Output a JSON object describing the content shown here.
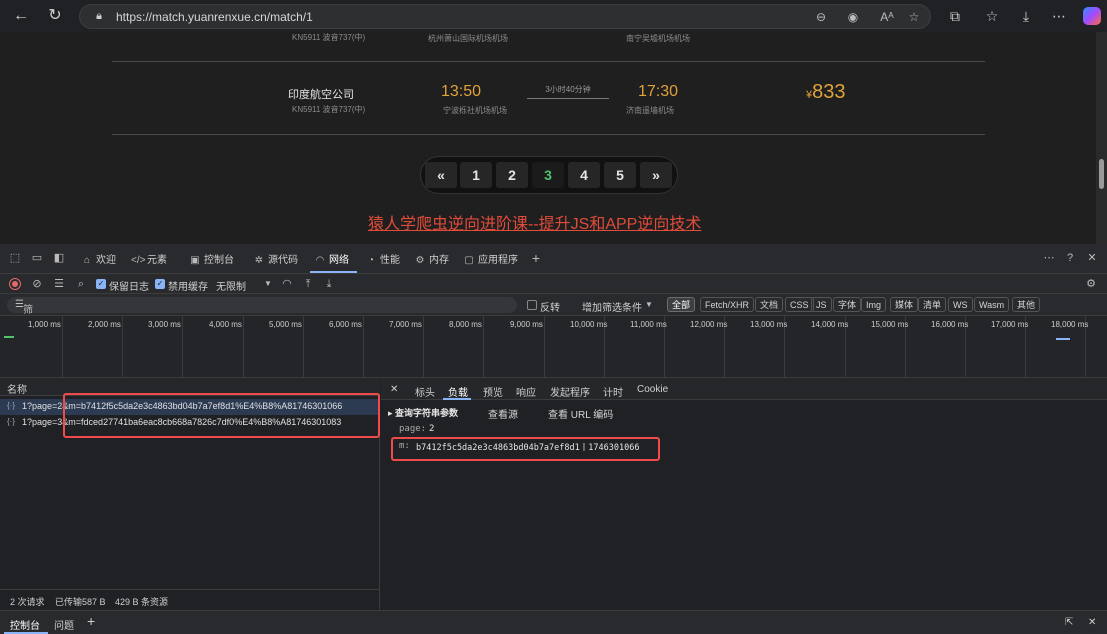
{
  "browser": {
    "url": "https://match.yuanrenxue.cn/match/1"
  },
  "page": {
    "prev_flight": {
      "code": "KN5911 波音737(中)",
      "from_airport": "杭州萧山国际机场机场",
      "to_airport": "南宁吴墟机场机场"
    },
    "flight": {
      "airline": "印度航空公司",
      "code": "KN5911 波音737(中)",
      "depart_time": "13:50",
      "depart_airport": "宁波栎社机场机场",
      "duration": "3小时40分钟",
      "arrive_time": "17:30",
      "arrive_airport": "济南遥墙机场",
      "currency": "¥",
      "price": "833"
    },
    "pagination": {
      "prev": "«",
      "pages": [
        "1",
        "2",
        "3",
        "4",
        "5"
      ],
      "active_page": "3",
      "next": "»"
    },
    "promo_link": "猿人学爬虫逆向进阶课--提升JS和APP逆向技术"
  },
  "devtools": {
    "tabs": [
      "欢迎",
      "元素",
      "控制台",
      "源代码",
      "网络",
      "性能",
      "内存",
      "应用程序"
    ],
    "active_tab": "网络",
    "toolbar": {
      "preserve_log": "保留日志",
      "disable_cache": "禁用缓存",
      "throttle": "无限制"
    },
    "filter": {
      "placeholder": "筛选器",
      "invert": "反转",
      "more_filters": "增加筛选条件",
      "types": [
        "全部",
        "Fetch/XHR",
        "文档",
        "CSS",
        "JS",
        "字体",
        "Img",
        "媒体",
        "清单",
        "WS",
        "Wasm",
        "其他"
      ],
      "active_type": "全部"
    },
    "timeline_ticks": [
      "1,000 ms",
      "2,000 ms",
      "3,000 ms",
      "4,000 ms",
      "5,000 ms",
      "6,000 ms",
      "7,000 ms",
      "8,000 ms",
      "9,000 ms",
      "10,000 ms",
      "11,000 ms",
      "12,000 ms",
      "13,000 ms",
      "14,000 ms",
      "15,000 ms",
      "16,000 ms",
      "17,000 ms",
      "18,000 ms"
    ],
    "requests_header": "名称",
    "requests": [
      {
        "name": "1?page=2&m=b7412f5c5da2e3c4863bd04b7a7ef8d1%E4%B8%A81746301066"
      },
      {
        "name": "1?page=3&m=fdced27741ba6eac8cb668a7826c7df0%E4%B8%A81746301083"
      }
    ],
    "status": {
      "requests": "2 次请求",
      "transferred": "已传输587 B",
      "resources": "429 B 条资源"
    },
    "detail_tabs": [
      "标头",
      "负载",
      "预览",
      "响应",
      "发起程序",
      "计时",
      "Cookie"
    ],
    "active_detail_tab": "负载",
    "payload": {
      "section_title": "查询字符串参数",
      "view_source": "查看源",
      "view_url_encoded": "查看 URL 编码",
      "params": [
        {
          "key": "page:",
          "value": "2"
        },
        {
          "key": "m:",
          "value": "b7412f5c5da2e3c4863bd04b7a7ef8d1丨1746301066"
        }
      ]
    },
    "drawer_tabs": [
      "控制台",
      "问题"
    ],
    "active_drawer_tab": "控制台"
  },
  "colors": {
    "accent_price": "#e0a23a",
    "active_page": "#4fc26b",
    "promo": "#e14b3a",
    "highlight_box": "#f04a4a",
    "devtools_accent": "#8ab4f8"
  }
}
